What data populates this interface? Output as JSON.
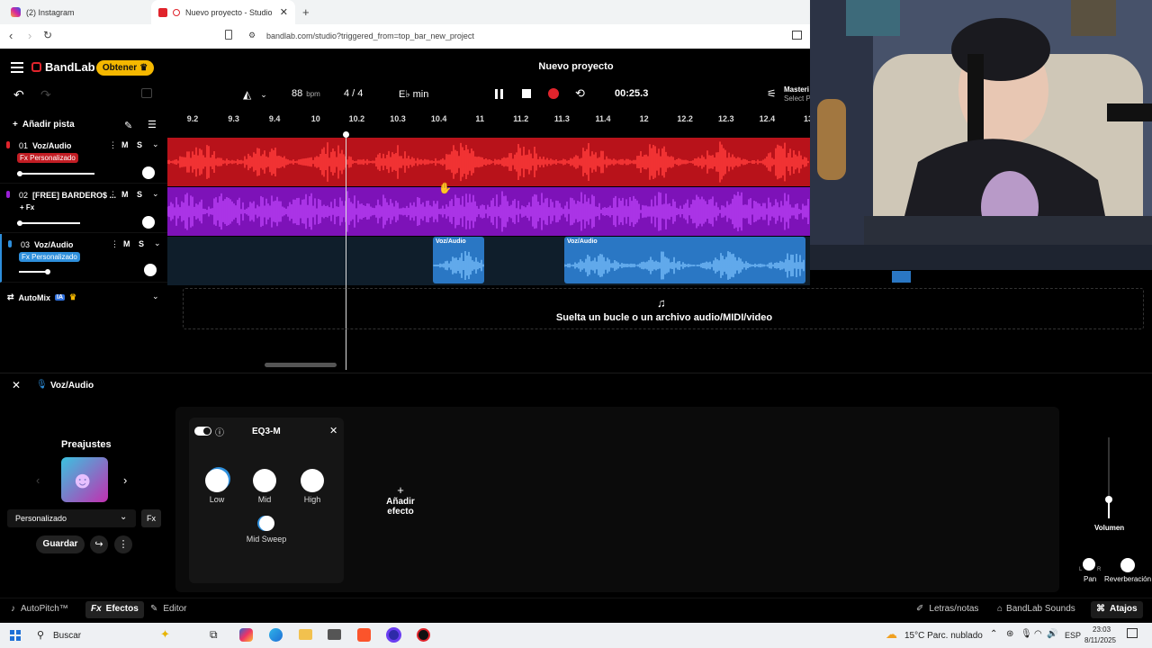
{
  "browser": {
    "tabs": [
      {
        "label": "(2) Instagram",
        "icon": "instagram-icon"
      },
      {
        "label": "Nuevo proyecto - Studio",
        "icon": "bandlab-icon"
      }
    ],
    "new_tab": "+",
    "url": "bandlab.com/studio?triggered_from=top_bar_new_project"
  },
  "app": {
    "logo": "BandLab",
    "get_button": "Obtener",
    "project_title": "Nuevo proyecto",
    "master_label": "Masteri",
    "master_sub": "Select P"
  },
  "transport": {
    "bpm": "88",
    "bpm_unit": "bpm",
    "time_signature": "4 / 4",
    "key": "E♭ min",
    "time": "00:25.3"
  },
  "ruler": {
    "ticks": [
      "9.2",
      "9.3",
      "9.4",
      "10",
      "10.2",
      "10.3",
      "10.4",
      "11",
      "11.2",
      "11.3",
      "11.4",
      "12",
      "12.2",
      "12.3",
      "12.4",
      "13"
    ]
  },
  "tracks_toolbar": {
    "add_track": "Añadir pista"
  },
  "tracks": [
    {
      "num": "01",
      "name": "Voz/Audio",
      "badge": "Fx Personalizado",
      "m": "M",
      "s": "S",
      "color": "#e0242c",
      "lane_color": "#b8121a",
      "volume": 0.6
    },
    {
      "num": "02",
      "name": "[FREE] BARDERO$ ...",
      "badge": "+ Fx",
      "m": "M",
      "s": "S",
      "color": "#9a1fd6",
      "lane_color": "#7d12b8",
      "volume": 0.5
    },
    {
      "num": "03",
      "name": "Voz/Audio",
      "badge": "Fx Personalizado",
      "m": "M",
      "s": "S",
      "color": "#2e8fdc",
      "lane_color": "#0f1e2b",
      "volume": 0.22
    }
  ],
  "clips": [
    {
      "label": "Voz/Audio"
    },
    {
      "label": "Voz/Audio"
    }
  ],
  "automix": {
    "label": "AutoMix",
    "badge": "IA"
  },
  "dropzone": {
    "text": "Suelta un bucle o un archivo audio/MIDI/video"
  },
  "fx_panel": {
    "track_title": "Voz/Audio",
    "presets_title": "Preajustes",
    "preset_name": "Personalizado",
    "save_button": "Guardar",
    "effect_name": "EQ3-M",
    "knobs": [
      "Low",
      "Mid",
      "High"
    ],
    "mid_sweep": "Mid Sweep",
    "add_effect": "Añadir efecto",
    "volume_label": "Volumen",
    "pan_label": "Pan",
    "reverb_label": "Reverberación",
    "pan_l": "L",
    "pan_r": "R"
  },
  "bottom_bar": {
    "autopitch": "AutoPitch™",
    "effects": "Efectos",
    "editor": "Editor",
    "lyrics": "Letras/notas",
    "sounds": "BandLab Sounds",
    "shortcuts": "Atajos"
  },
  "taskbar": {
    "search": "Buscar",
    "weather": "15°C  Parc. nublado",
    "lang": "ESP",
    "time": "23:03",
    "date": "8/11/2025"
  }
}
